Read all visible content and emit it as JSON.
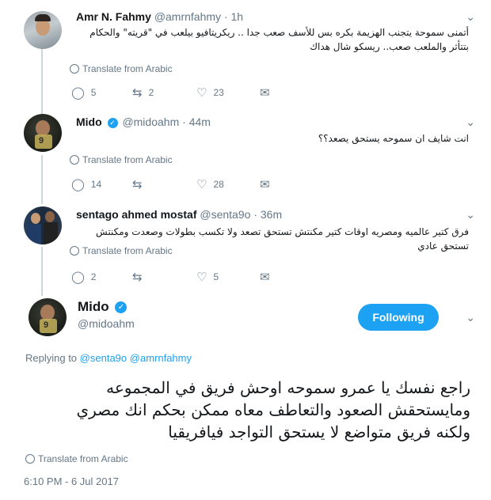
{
  "tweets": [
    {
      "name": "Amr N. Fahmy",
      "handle": "@amrnfahmy",
      "dot": "·",
      "time": "1h",
      "text": "أتمنى سموحة يتجنب الهزيمة بكره بس للأسف صعب جدا .. ريكريتافيو بيلعب في \"قريته\" والحكام بتتأثر والملعب صعب.. ريسكو شال هداك",
      "translate": "Translate from Arabic",
      "replies": "5",
      "retweets": "2",
      "likes": "23"
    },
    {
      "name": "Mido",
      "handle": "@midoahm",
      "dot": "·",
      "time": "44m",
      "text": "انت شايف ان سموحه يستحق يصعد؟؟",
      "translate": "Translate from Arabic",
      "replies": "14",
      "retweets": "",
      "likes": "28"
    },
    {
      "name": "sentago ahmed mostaf",
      "handle": "@senta9o",
      "dot": "·",
      "time": "36m",
      "text": "فرق كتير عالميه ومصريه اوقات كتير مكنتش تستحق تصعد ولا تكسب بطولات وصعدت ومكنتش تستحق عادي",
      "translate": "Translate from Arabic",
      "replies": "2",
      "retweets": "",
      "likes": "5"
    }
  ],
  "main": {
    "name": "Mido",
    "handle": "@midoahm",
    "follow_label": "Following",
    "replying_prefix": "Replying to",
    "replying_1": "@senta9o",
    "replying_2": "@amrnfahmy",
    "text_line1": "راجع نفسك يا عمرو سموحه اوحش فريق في المجموعه",
    "text_line2": "ومايستحقش الصعود والتعاطف معاه ممكن بحكم انك مصري",
    "text_line3": "ولكنه فريق متواضع لا يستحق التواجد فيافريقيا",
    "translate": "Translate from Arabic",
    "timestamp": "6:10 PM - 6 Jul 2017"
  },
  "avatar_jersey_number": "9",
  "icons": {
    "reply": "reply-icon",
    "retweet": "retweet-icon",
    "like": "heart-icon",
    "dm": "envelope-icon",
    "translate": "globe-icon",
    "verified": "verified-badge-icon",
    "more": "chevron-down-icon"
  },
  "colors": {
    "accent": "#1da1f2",
    "muted": "#657786",
    "text": "#14171a",
    "thread_line": "#ccd6dd"
  }
}
